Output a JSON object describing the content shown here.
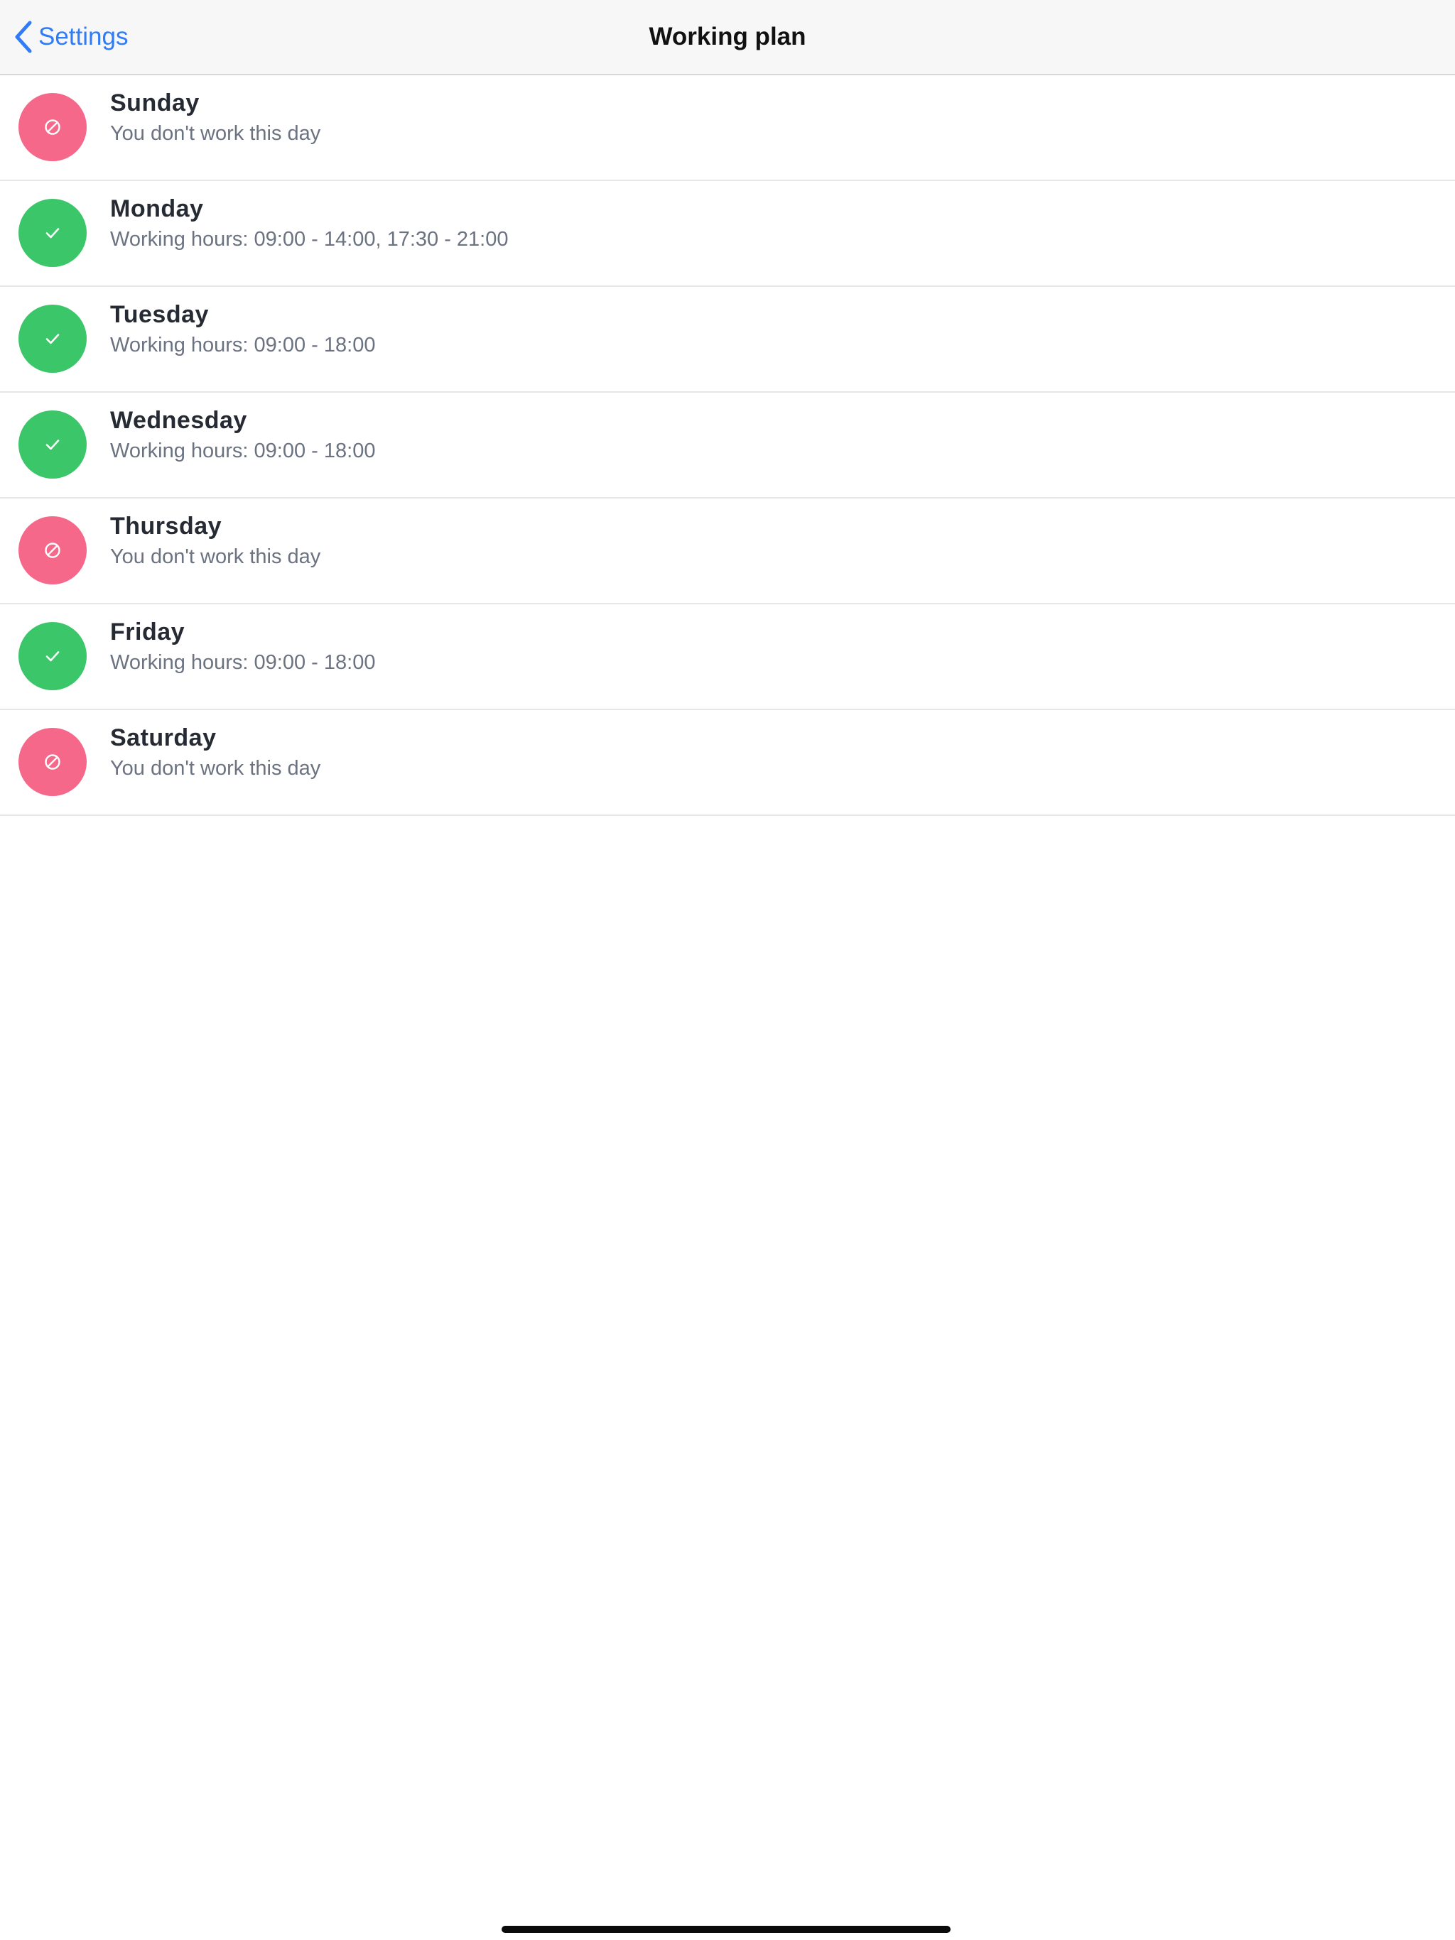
{
  "navbar": {
    "back_label": "Settings",
    "back_icon": "chevron-left-icon",
    "title": "Working plan"
  },
  "colors": {
    "accent": "#2f7cf6",
    "working": "#3cc66a",
    "off": "#f6688a"
  },
  "days": [
    {
      "name": "Sunday",
      "detail": "You don't work this day",
      "status": "off",
      "icon": "prohibited-icon"
    },
    {
      "name": "Monday",
      "detail": "Working hours: 09:00 - 14:00, 17:30 - 21:00",
      "status": "working",
      "icon": "checkmark-icon"
    },
    {
      "name": "Tuesday",
      "detail": "Working hours: 09:00 - 18:00",
      "status": "working",
      "icon": "checkmark-icon"
    },
    {
      "name": "Wednesday",
      "detail": "Working hours: 09:00 - 18:00",
      "status": "working",
      "icon": "checkmark-icon"
    },
    {
      "name": "Thursday",
      "detail": "You don't work this day",
      "status": "off",
      "icon": "prohibited-icon"
    },
    {
      "name": "Friday",
      "detail": "Working hours: 09:00 - 18:00",
      "status": "working",
      "icon": "checkmark-icon"
    },
    {
      "name": "Saturday",
      "detail": "You don't work this day",
      "status": "off",
      "icon": "prohibited-icon"
    }
  ]
}
